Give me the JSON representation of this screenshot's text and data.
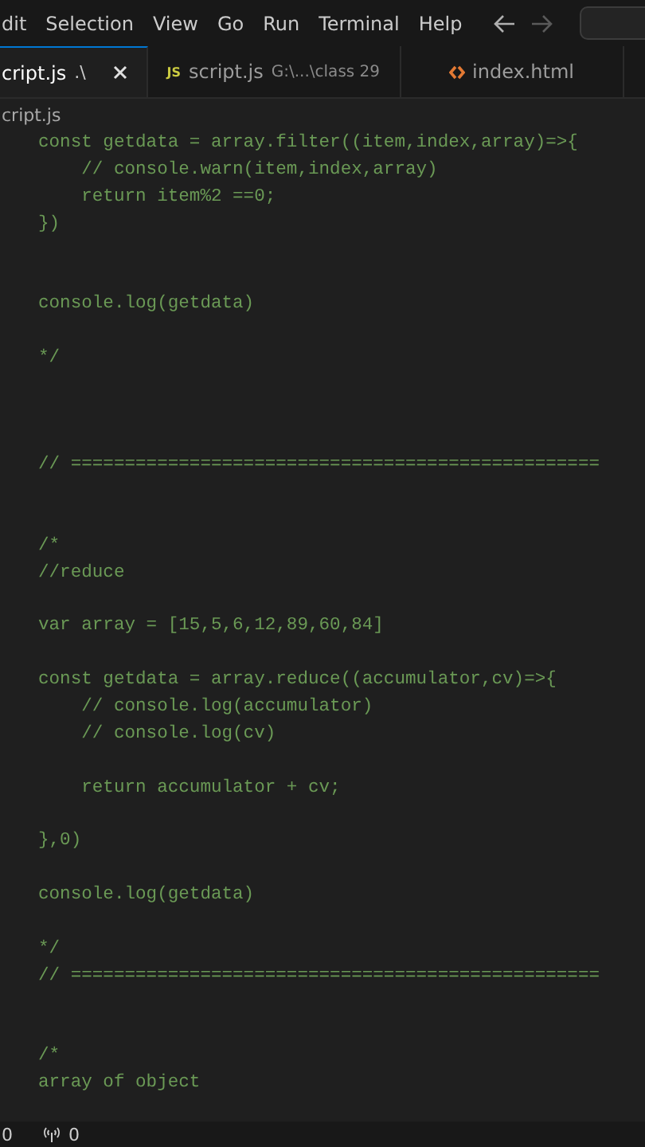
{
  "menu": [
    "dit",
    "Selection",
    "View",
    "Go",
    "Run",
    "Terminal",
    "Help"
  ],
  "tabs": [
    {
      "label": "cript.js",
      "path": ".\\",
      "kind": "plain",
      "selected": true
    },
    {
      "label": "script.js",
      "path": "G:\\...\\class 29",
      "kind": "js",
      "icon_text": "JS",
      "selected": false
    },
    {
      "label": "index.html",
      "kind": "html",
      "selected": false
    }
  ],
  "breadcrumb": "cript.js",
  "code_lines": [
    {
      "kind": "code",
      "text": "const getdata = array.filter((item,index,array)=>{"
    },
    {
      "kind": "code",
      "text": "    // console.warn(item,index,array)"
    },
    {
      "kind": "code",
      "text": "    return item%2 ==0;"
    },
    {
      "kind": "code",
      "text": "})"
    },
    {
      "kind": "blank"
    },
    {
      "kind": "blank"
    },
    {
      "kind": "code",
      "text": "console.log(getdata)"
    },
    {
      "kind": "blank"
    },
    {
      "kind": "code",
      "text": "*/"
    },
    {
      "kind": "blank"
    },
    {
      "kind": "blank"
    },
    {
      "kind": "blank"
    },
    {
      "kind": "code",
      "text": "// ================================================="
    },
    {
      "kind": "blank"
    },
    {
      "kind": "blank"
    },
    {
      "kind": "code",
      "text": "/*"
    },
    {
      "kind": "code",
      "text": "//reduce"
    },
    {
      "kind": "blank"
    },
    {
      "kind": "code",
      "text": "var array = [15,5,6,12,89,60,84]"
    },
    {
      "kind": "blank"
    },
    {
      "kind": "code",
      "text": "const getdata = array.reduce((accumulator,cv)=>{"
    },
    {
      "kind": "code",
      "text": "    // console.log(accumulator)"
    },
    {
      "kind": "code",
      "text": "    // console.log(cv)"
    },
    {
      "kind": "blank"
    },
    {
      "kind": "code",
      "text": "    return accumulator + cv;"
    },
    {
      "kind": "blank"
    },
    {
      "kind": "code",
      "text": "},0)"
    },
    {
      "kind": "blank"
    },
    {
      "kind": "code",
      "text": "console.log(getdata)"
    },
    {
      "kind": "blank"
    },
    {
      "kind": "code",
      "text": "*/"
    },
    {
      "kind": "code",
      "text": "// ================================================="
    },
    {
      "kind": "blank"
    },
    {
      "kind": "blank"
    },
    {
      "kind": "code",
      "text": "/*"
    },
    {
      "kind": "code",
      "text": "array of object"
    }
  ],
  "status_bar": {
    "errors": "0",
    "ports": "0"
  }
}
